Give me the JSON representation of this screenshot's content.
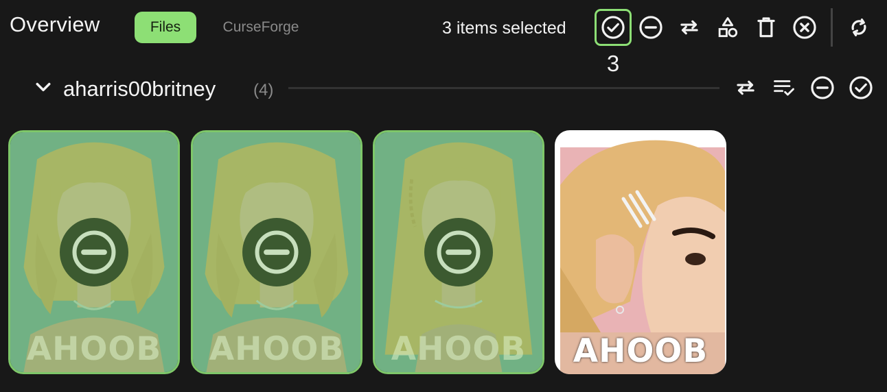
{
  "header": {
    "title": "Overview",
    "tabs": [
      {
        "label": "Files",
        "active": true
      },
      {
        "label": "CurseForge",
        "active": false
      }
    ],
    "selection_status": "3 items selected",
    "selection_count": "3",
    "toolbar_icons": [
      "check-circle-icon",
      "minus-circle-icon",
      "swap-icon",
      "shapes-icon",
      "trash-icon",
      "close-circle-icon",
      "sync-icon"
    ]
  },
  "group": {
    "name": "aharris00britney",
    "count": "(4)",
    "action_icons": [
      "swap-icon",
      "list-check-icon",
      "minus-circle-icon",
      "check-circle-icon"
    ]
  },
  "cards": [
    {
      "watermark": "AHOOB",
      "selected": true,
      "variant": "bob"
    },
    {
      "watermark": "AHOOB",
      "selected": true,
      "variant": "bob-wavy"
    },
    {
      "watermark": "AHOOB",
      "selected": true,
      "variant": "long-braid"
    },
    {
      "watermark": "AHOOB",
      "selected": false,
      "variant": "closeup-pins"
    }
  ],
  "colors": {
    "background": "#181818",
    "accent": "#8ddf75",
    "selection_border": "#7ec769",
    "muted_text": "#8a8a8a"
  }
}
